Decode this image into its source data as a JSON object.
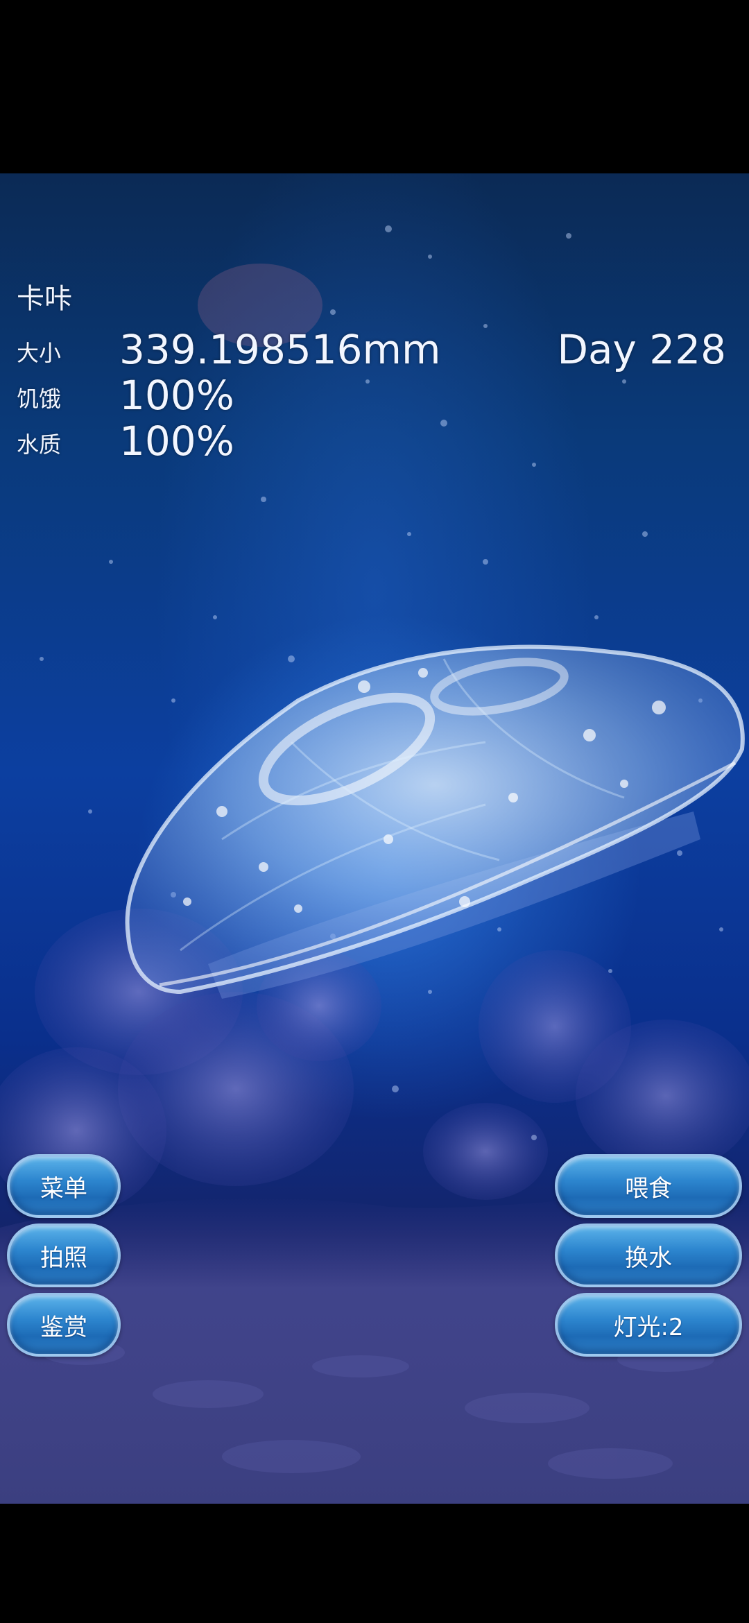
{
  "pet": {
    "name": "卡咔",
    "size_label": "大小",
    "size_value": "339.198516mm",
    "hunger_label": "饥饿",
    "hunger_value": "100%",
    "water_label": "水质",
    "water_value": "100%",
    "day": "Day 228"
  },
  "buttons": {
    "menu": "菜单",
    "photo": "拍照",
    "appreciate": "鉴赏",
    "feed": "喂食",
    "change_water": "换水",
    "light": "灯光:2"
  },
  "colors": {
    "water_top": "#0b2a55",
    "water_mid": "#0c3fa0",
    "button_fill": "#2d86cf",
    "button_border": "#aacdf0",
    "text": "#f2f6ff"
  }
}
